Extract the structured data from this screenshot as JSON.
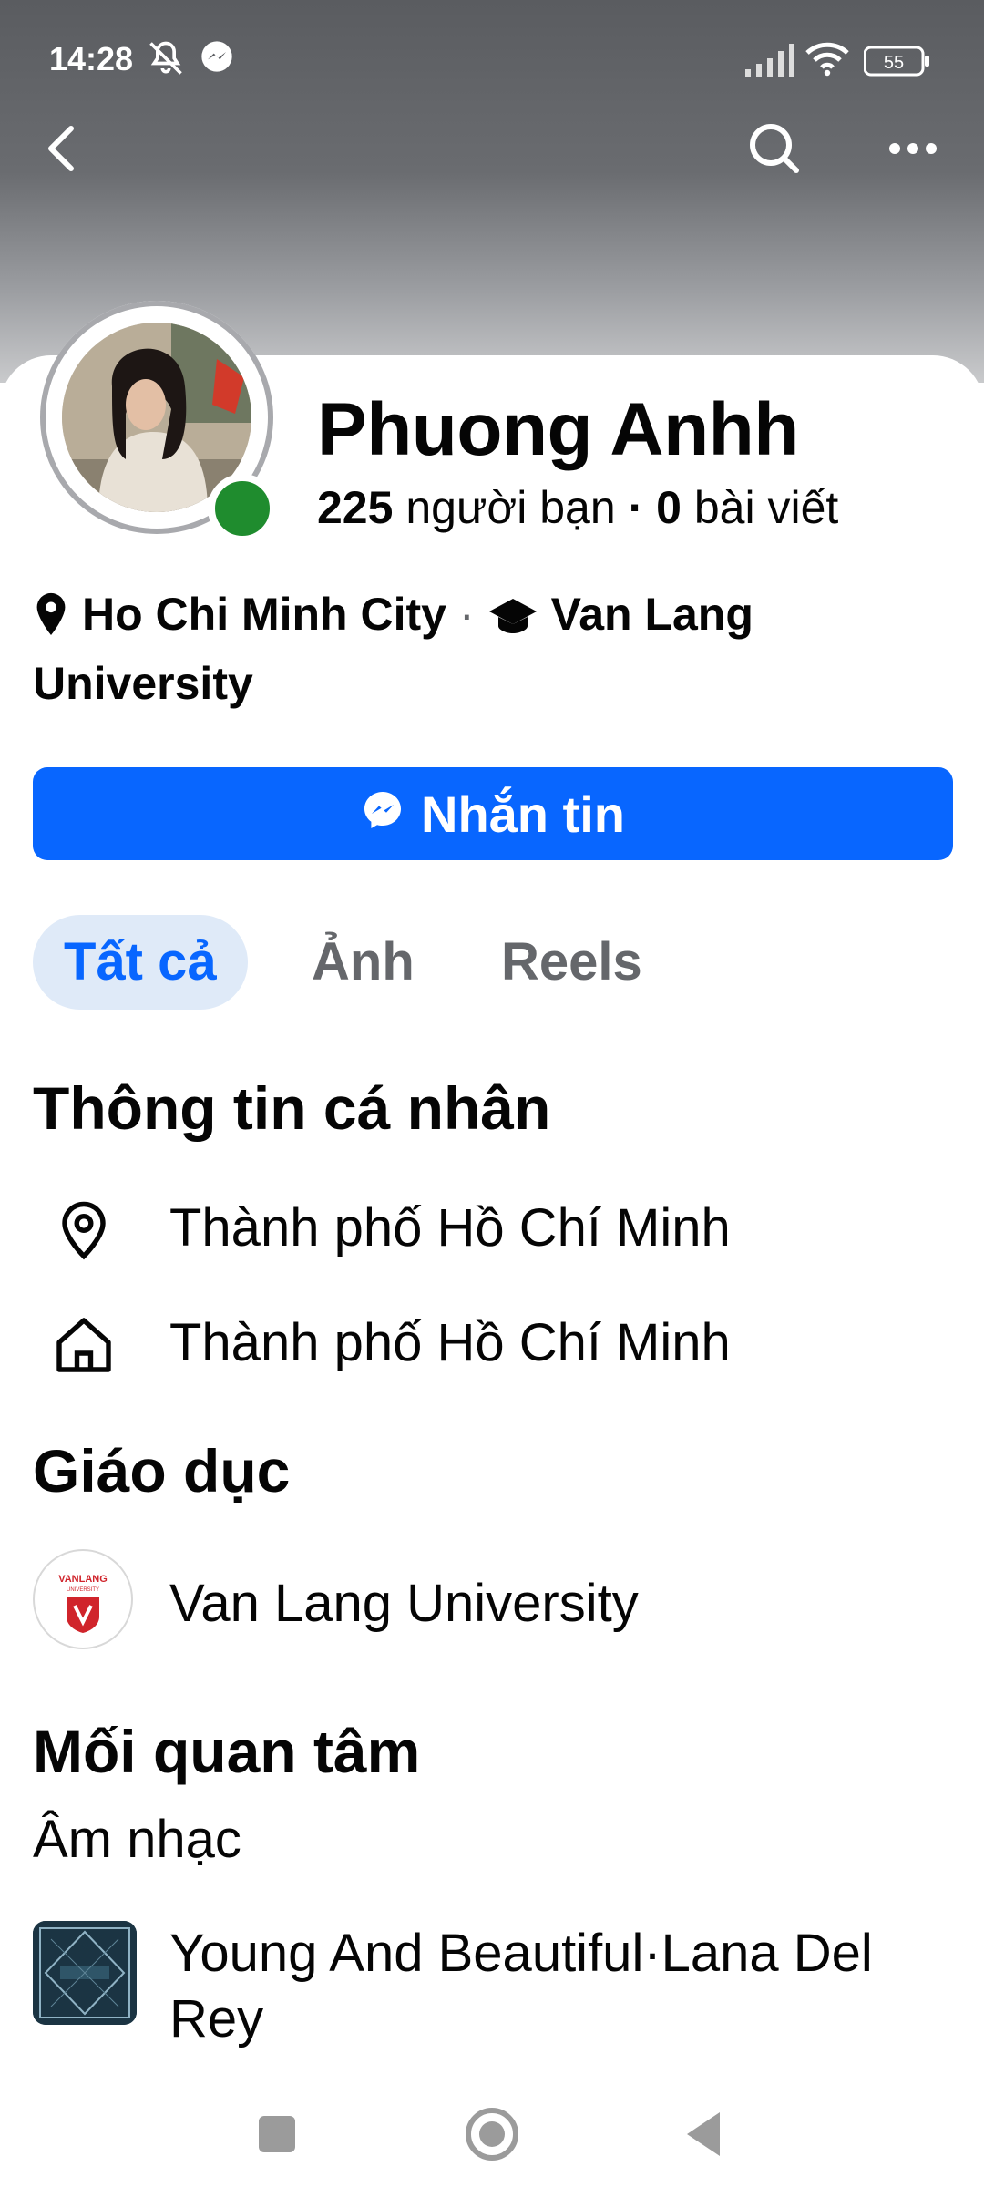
{
  "status_bar": {
    "time": "14:28",
    "battery": "55"
  },
  "profile": {
    "name": "Phuong Anhh",
    "friends_count": "225",
    "friends_label": "người bạn",
    "separator": "·",
    "posts_count": "0",
    "posts_label": "bài viết",
    "online": true,
    "location": "Ho Chi Minh City",
    "school_line1": "Van Lang",
    "school_line2": "University"
  },
  "message_button": {
    "label": "Nhắn tin"
  },
  "tabs": [
    {
      "label": "Tất cả",
      "active": true
    },
    {
      "label": "Ảnh",
      "active": false
    },
    {
      "label": "Reels",
      "active": false
    }
  ],
  "personal_info": {
    "heading": "Thông tin cá nhân",
    "current_city": "Thành phố Hồ Chí Minh",
    "hometown": "Thành phố Hồ Chí Minh"
  },
  "education": {
    "heading": "Giáo dục",
    "school": "Van Lang University",
    "logo_text_top": "VANLANG",
    "logo_text_bottom": "UNIVERSITY"
  },
  "interests": {
    "heading": "Mối quan tâm",
    "category": "Âm nhạc",
    "music_item": "Young And Beautiful·Lana Del Rey"
  },
  "colors": {
    "accent": "#0866ff",
    "online": "#1f8c2e",
    "tab_active_bg": "#dfeaf8",
    "muted": "#65676b"
  },
  "icons": {
    "back": "back-arrow-icon",
    "search": "search-icon",
    "more": "more-icon",
    "location": "location-pin-icon",
    "school": "graduation-cap-icon",
    "messenger": "messenger-icon",
    "home": "home-icon"
  }
}
